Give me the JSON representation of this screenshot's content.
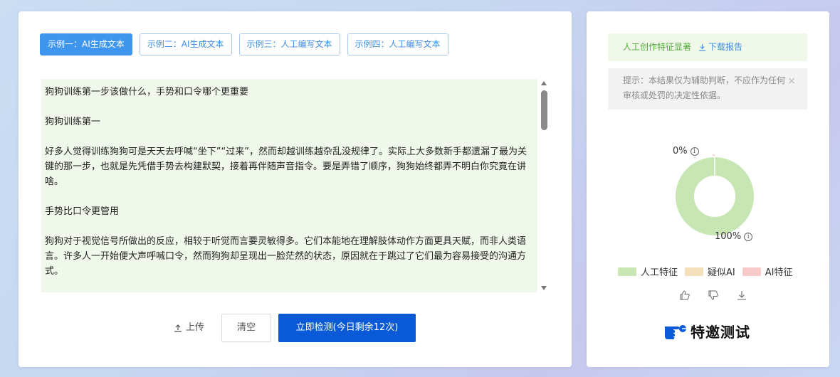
{
  "tabs": [
    {
      "label": "示例一：AI生成文本",
      "active": true
    },
    {
      "label": "示例二：AI生成文本",
      "active": false
    },
    {
      "label": "示例三：人工编写文本",
      "active": false
    },
    {
      "label": "示例四：人工编写文本",
      "active": false
    }
  ],
  "text": {
    "paragraphs": [
      "狗狗训练第一步该做什么，手势和口令哪个更重要",
      "狗狗训练第一",
      "好多人觉得训练狗狗可是天天去呼喊“坐下”“过来”，然而却越训练越杂乱没规律了。实际上大多数新手都遗漏了最为关键的那一步，也就是先凭借手势去构建默契，接着再伴随声音指令。要是弄错了顺序，狗狗始终都弄不明白你究竟在讲啥。",
      "手势比口令更管用",
      "狗狗对于视觉信号所做出的反应，相较于听觉而言要灵敏得多。它们本能地在理解肢体动作方面更具天赋，而非人类语言。许多人一开始便大声呼喊口令，然而狗狗却呈现出一脸茫然的状态，原因就在于跳过了它们最为容易接受的沟通方式。"
    ]
  },
  "actions": {
    "upload": "上传",
    "clear": "清空",
    "detect": "立即检测(今日剩余12次)"
  },
  "result": {
    "status": "人工创作特征显著",
    "download": "下载报告",
    "tip": "提示：本结果仅为辅助判断，不应作为任何审核或处罚的决定性依据。",
    "close_icon": "×"
  },
  "chart_data": {
    "type": "pie",
    "labels": [
      "人工特征",
      "疑似AI",
      "AI特征"
    ],
    "values": [
      100,
      0,
      0
    ],
    "colors": [
      "#c8e6b4",
      "#f4dfbb",
      "#f8c9c9"
    ],
    "top_label": "0%",
    "bottom_label": "100%",
    "info_icon": "i"
  },
  "legend": [
    {
      "label": "人工特征",
      "color": "#c8e6b4"
    },
    {
      "label": "疑似AI",
      "color": "#f4dfbb"
    },
    {
      "label": "AI特征",
      "color": "#f8c9c9"
    }
  ],
  "feedback_icons": [
    "thumbs-up-icon",
    "thumbs-down-icon",
    "download-icon"
  ],
  "brand": {
    "text": "特邀测试",
    "color": "#0a5ad8"
  },
  "colors": {
    "primary": "#0a5ad8",
    "tab_active": "#3f96ee",
    "success": "#52a83a"
  }
}
